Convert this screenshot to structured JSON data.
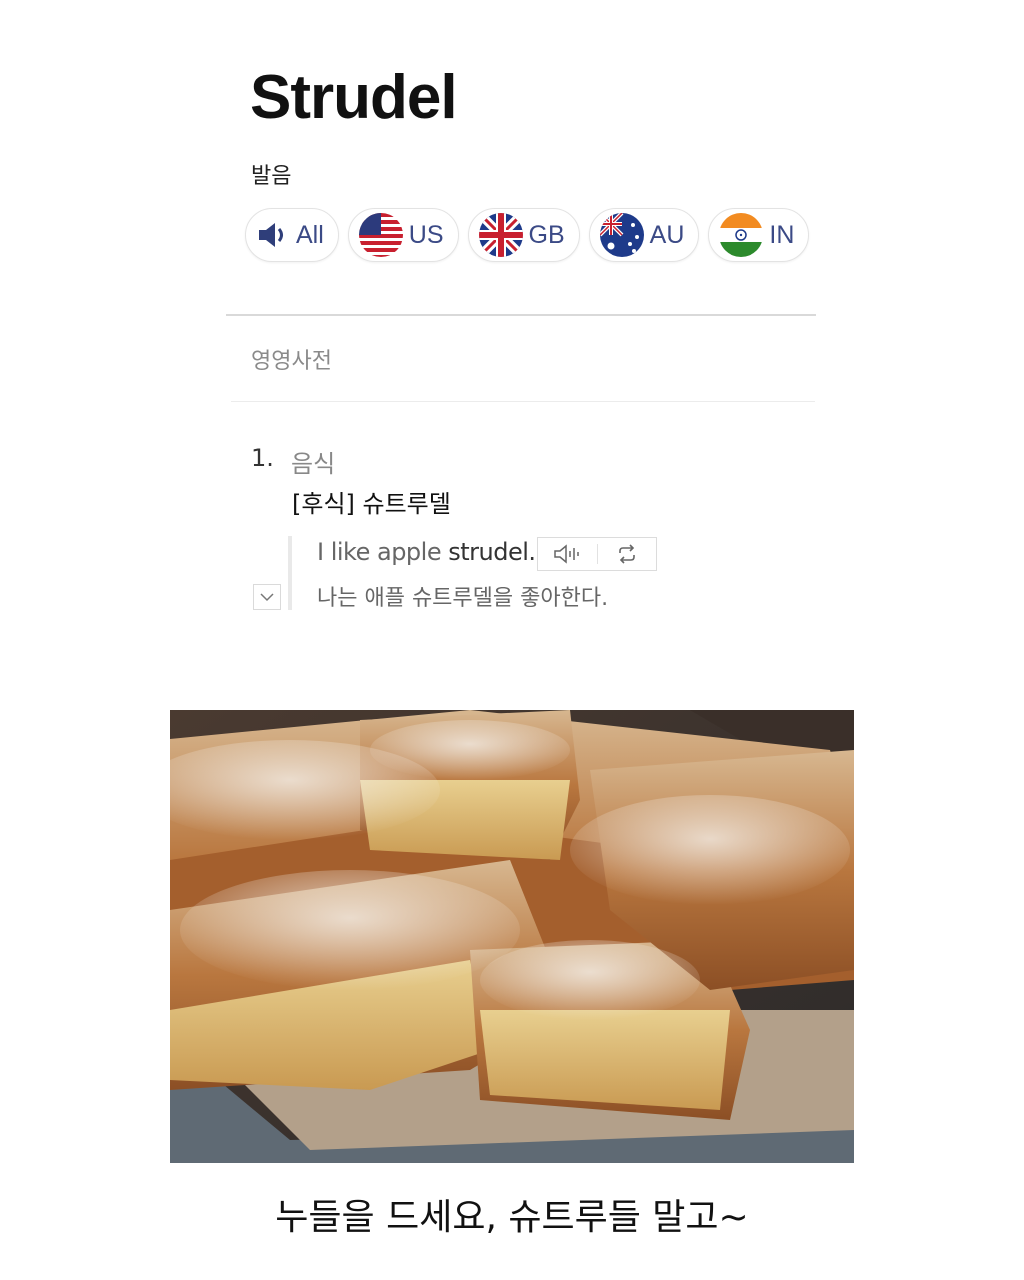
{
  "entry": {
    "word": "Strudel",
    "pronunciation_label": "발음",
    "pronunciation_buttons": [
      {
        "label": "All",
        "icon": "speaker-icon"
      },
      {
        "label": "US",
        "icon": "us-flag-icon"
      },
      {
        "label": "GB",
        "icon": "gb-flag-icon"
      },
      {
        "label": "AU",
        "icon": "au-flag-icon"
      },
      {
        "label": "IN",
        "icon": "in-flag-icon"
      }
    ]
  },
  "dictionary": {
    "section_title": "영영사전",
    "definitions": [
      {
        "number": "1.",
        "category": "음식",
        "meaning": "[후식] 슈트루델",
        "example": {
          "en_prefix": "I like apple ",
          "en_keyword": "strudel.",
          "ko": "나는 애플 슈트루델을 좋아한다."
        }
      }
    ]
  },
  "caption": "누들을 드세요, 슈트루들 말고~",
  "colors": {
    "accent_blue": "#3b4a86"
  }
}
